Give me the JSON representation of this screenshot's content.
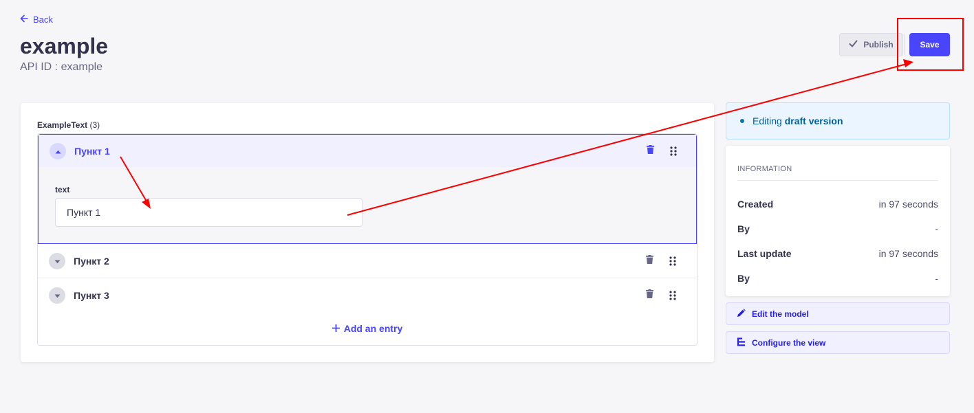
{
  "header": {
    "back_label": "Back",
    "title": "example",
    "api_id": "API ID : example",
    "publish_label": "Publish",
    "save_label": "Save"
  },
  "component": {
    "field_name": "ExampleText",
    "field_count": "(3)",
    "items": [
      {
        "title": "Пункт 1",
        "expanded": true,
        "field_label": "text",
        "field_value": "Пункт 1"
      },
      {
        "title": "Пункт 2",
        "expanded": false
      },
      {
        "title": "Пункт 3",
        "expanded": false
      }
    ],
    "add_label": "Add an entry"
  },
  "sidebar": {
    "draft_prefix": "Editing",
    "draft_strong": "draft version",
    "info_title": "Information",
    "rows": [
      {
        "key": "Created",
        "value": "in 97 seconds"
      },
      {
        "key": "By",
        "value": "-"
      },
      {
        "key": "Last update",
        "value": "in 97 seconds"
      },
      {
        "key": "By",
        "value": "-"
      }
    ],
    "edit_model_label": "Edit the model",
    "configure_view_label": "Configure the view"
  },
  "icons": {
    "back": "arrow-left-icon",
    "publish": "check-icon",
    "toggle_open": "chevron-up-icon",
    "toggle_closed": "chevron-down-icon",
    "delete": "trash-icon",
    "drag": "drag-handle-icon",
    "add": "plus-icon",
    "edit": "pencil-icon",
    "configure": "layout-icon"
  },
  "colors": {
    "primary": "#4945ff",
    "annotation": "#ff0000",
    "draft_bg": "#eaf5ff",
    "draft_text": "#006096"
  }
}
